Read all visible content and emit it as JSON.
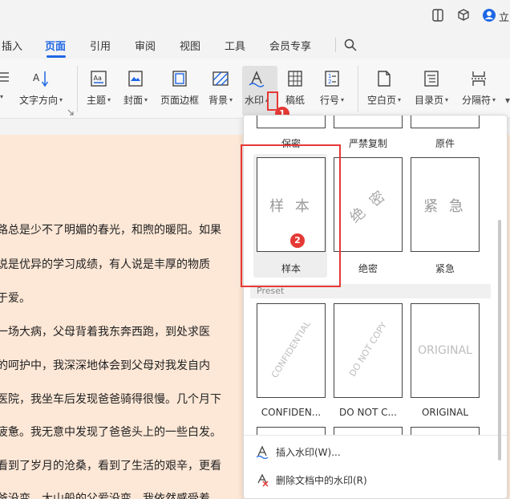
{
  "user": {
    "name_partial": "立"
  },
  "menu": {
    "tabs": [
      {
        "label": "插入"
      },
      {
        "label": "页面"
      },
      {
        "label": "引用"
      },
      {
        "label": "审阅"
      },
      {
        "label": "视图"
      },
      {
        "label": "工具"
      },
      {
        "label": "会员专享"
      }
    ],
    "active_tab": "页面"
  },
  "ribbon": {
    "text_direction": "文字方向",
    "theme": "主题",
    "cover": "封面",
    "page_border": "页面边框",
    "background": "背景",
    "watermark": "水印",
    "manuscript": "稿纸",
    "line_number": "行号",
    "blank_page": "空白页",
    "toc_page": "目录页",
    "separator": "分隔符"
  },
  "document": {
    "lines": [
      "路总是少不了明媚的春光，和煦的暖阳。如果",
      "说是优异的学习成绩，有人说是丰厚的物质",
      "于爱。",
      "一场大病，父母背着我东奔西跑，到处求医",
      "的呵护中，我深深地体会到父母对我发自内",
      "医院，我坐车后发现爸爸骑得很慢。几个月下",
      "疲惫。我无意中发现了爸爸头上的一些白发。",
      "看到了岁月的沧桑，看到了生活的艰辛，更看",
      "爸没变，大山般的父爱没变，我依然感受着"
    ]
  },
  "watermark_panel": {
    "top_row_labels": [
      "保密",
      "严禁复制",
      "原件"
    ],
    "custom_cards": [
      {
        "label": "样本",
        "text": "样 本"
      },
      {
        "label": "绝密",
        "text": "绝 密"
      },
      {
        "label": "紧急",
        "text": "紧 急"
      }
    ],
    "preset_header": "Preset",
    "preset_cards": [
      {
        "label": "CONFIDEN...",
        "text": "CONFIDENTIAL"
      },
      {
        "label": "DO NOT C...",
        "text": "DO NOT COPY"
      },
      {
        "label": "ORIGINAL",
        "text": "ORIGINAL"
      }
    ],
    "insert_watermark": "插入水印(W)...",
    "remove_watermark": "删除文档中的水印(R)"
  },
  "annotations": {
    "badge_1": "1",
    "badge_2": "2",
    "accent_color": "#e53935"
  },
  "colors": {
    "brand": "#1f66e5",
    "doc_bg": "#fde7d6"
  }
}
